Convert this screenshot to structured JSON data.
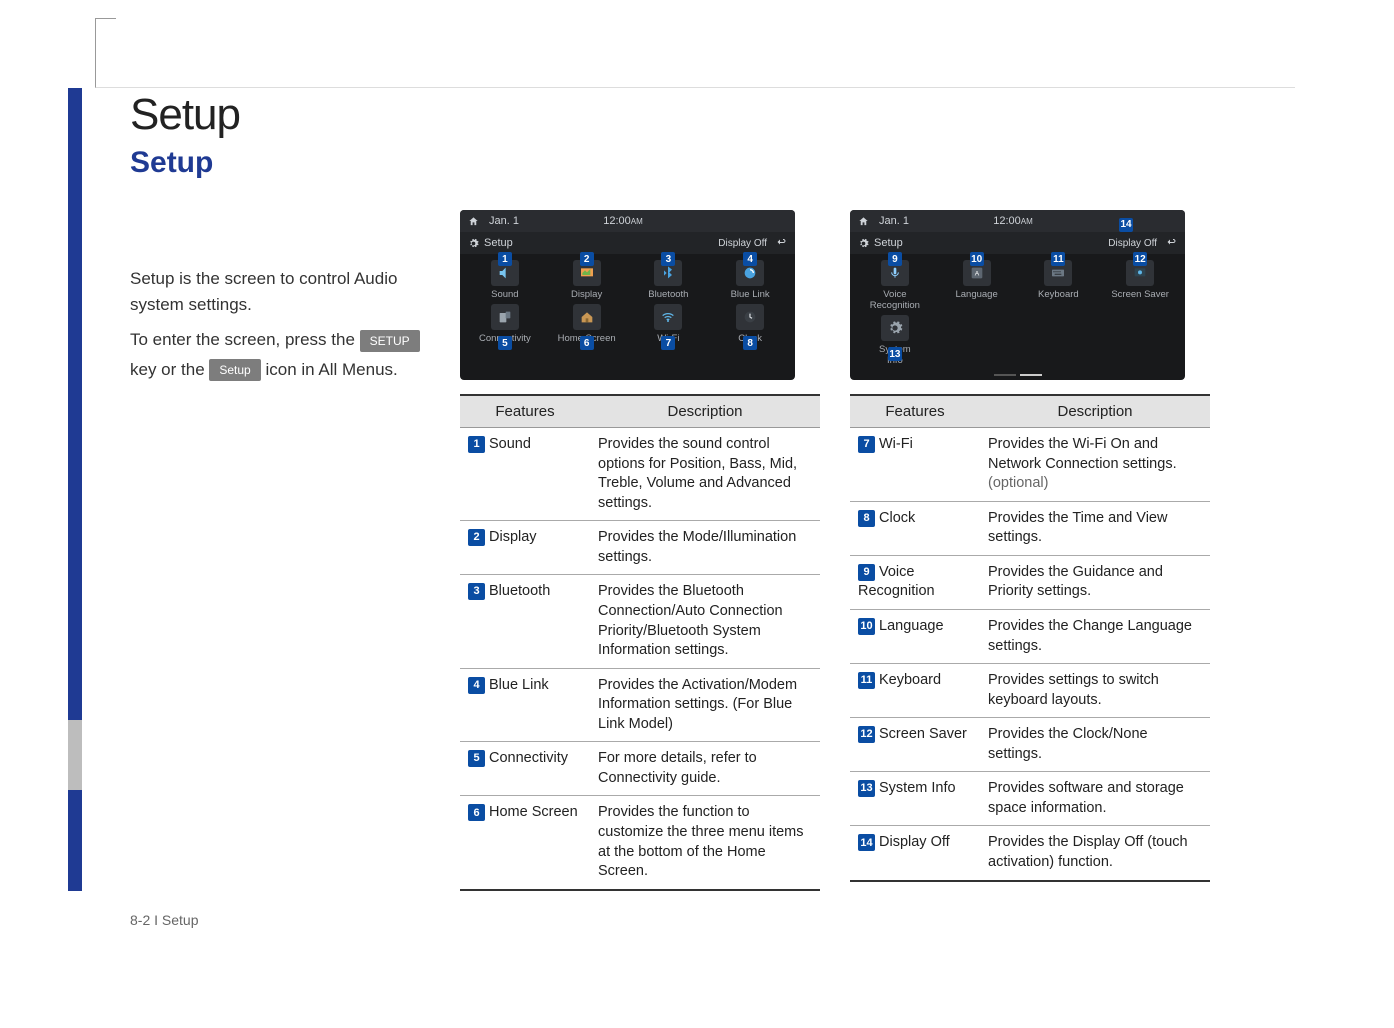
{
  "page": {
    "title": "Setup",
    "subtitle": "Setup",
    "footer": "8-2 I Setup"
  },
  "intro": {
    "p1": "Setup is the screen to control Audio system settings.",
    "p2a": "To enter the screen, press the ",
    "p2key": "SETUP",
    "p3a": "key or the ",
    "p3key": "Setup",
    "p3b": " icon in All Menus."
  },
  "shot": {
    "date": "Jan. 1",
    "time": "12:00",
    "ampm": "AM",
    "titlebar": "Setup",
    "displayoff": "Display Off"
  },
  "shot1icons": [
    {
      "n": "1",
      "label": "Sound",
      "icon": "speaker"
    },
    {
      "n": "2",
      "label": "Display",
      "icon": "display"
    },
    {
      "n": "3",
      "label": "Bluetooth",
      "icon": "bluetooth"
    },
    {
      "n": "4",
      "label": "Blue Link",
      "icon": "bluelink"
    },
    {
      "n": "5",
      "label": "Connectivity",
      "icon": "connectivity"
    },
    {
      "n": "6",
      "label": "Home Screen",
      "icon": "homescreen"
    },
    {
      "n": "7",
      "label": "Wi-Fi",
      "icon": "wifi"
    },
    {
      "n": "8",
      "label": "Clock",
      "icon": "clock"
    }
  ],
  "shot2icons": [
    {
      "n": "9",
      "label": "Voice\nRecognition",
      "icon": "voice"
    },
    {
      "n": "10",
      "label": "Language",
      "icon": "language"
    },
    {
      "n": "11",
      "label": "Keyboard",
      "icon": "keyboard"
    },
    {
      "n": "12",
      "label": "Screen Saver",
      "icon": "screensaver"
    },
    {
      "n": "13",
      "label": "System\nInfo",
      "icon": "sysinfo"
    }
  ],
  "shot2_displayoff_n": "14",
  "thead": {
    "features": "Features",
    "description": "Description"
  },
  "table1": [
    {
      "n": "1",
      "feat": "Sound",
      "desc": "Provides the sound control options for Position, Bass, Mid, Treble, Volume and Advanced settings."
    },
    {
      "n": "2",
      "feat": "Display",
      "desc": "Provides the Mode/Illumination settings."
    },
    {
      "n": "3",
      "feat": "Bluetooth",
      "desc": "Provides the Bluetooth Connection/Auto Connection Priority/Bluetooth System Information settings."
    },
    {
      "n": "4",
      "feat": "Blue Link",
      "desc": "Provides the Activation/Modem Information settings. (For Blue Link Model)"
    },
    {
      "n": "5",
      "feat": "Connectivity",
      "desc": "For more details, refer to Connectivity guide."
    },
    {
      "n": "6",
      "feat": "Home Screen",
      "desc": "Provides the function to customize the three menu items at the bottom of the Home Screen."
    }
  ],
  "table2": [
    {
      "n": "7",
      "feat": "Wi-Fi",
      "desc": "Provides the Wi-Fi On and Network Connection settings. ",
      "opt": "(optional)"
    },
    {
      "n": "8",
      "feat": "Clock",
      "desc": "Provides the Time and View settings."
    },
    {
      "n": "9",
      "feat": "Voice Recognition",
      "desc": "Provides the Guidance and Priority settings."
    },
    {
      "n": "10",
      "feat": "Language",
      "desc": "Provides the Change Language settings."
    },
    {
      "n": "11",
      "feat": "Keyboard",
      "desc": "Provides settings to switch keyboard layouts."
    },
    {
      "n": "12",
      "feat": "Screen Saver",
      "desc": "Provides the Clock/None settings."
    },
    {
      "n": "13",
      "feat": "System Info",
      "desc": "Provides software and storage space information."
    },
    {
      "n": "14",
      "feat": "Display Off",
      "desc": "Provides the Display Off (touch activation) function."
    }
  ]
}
